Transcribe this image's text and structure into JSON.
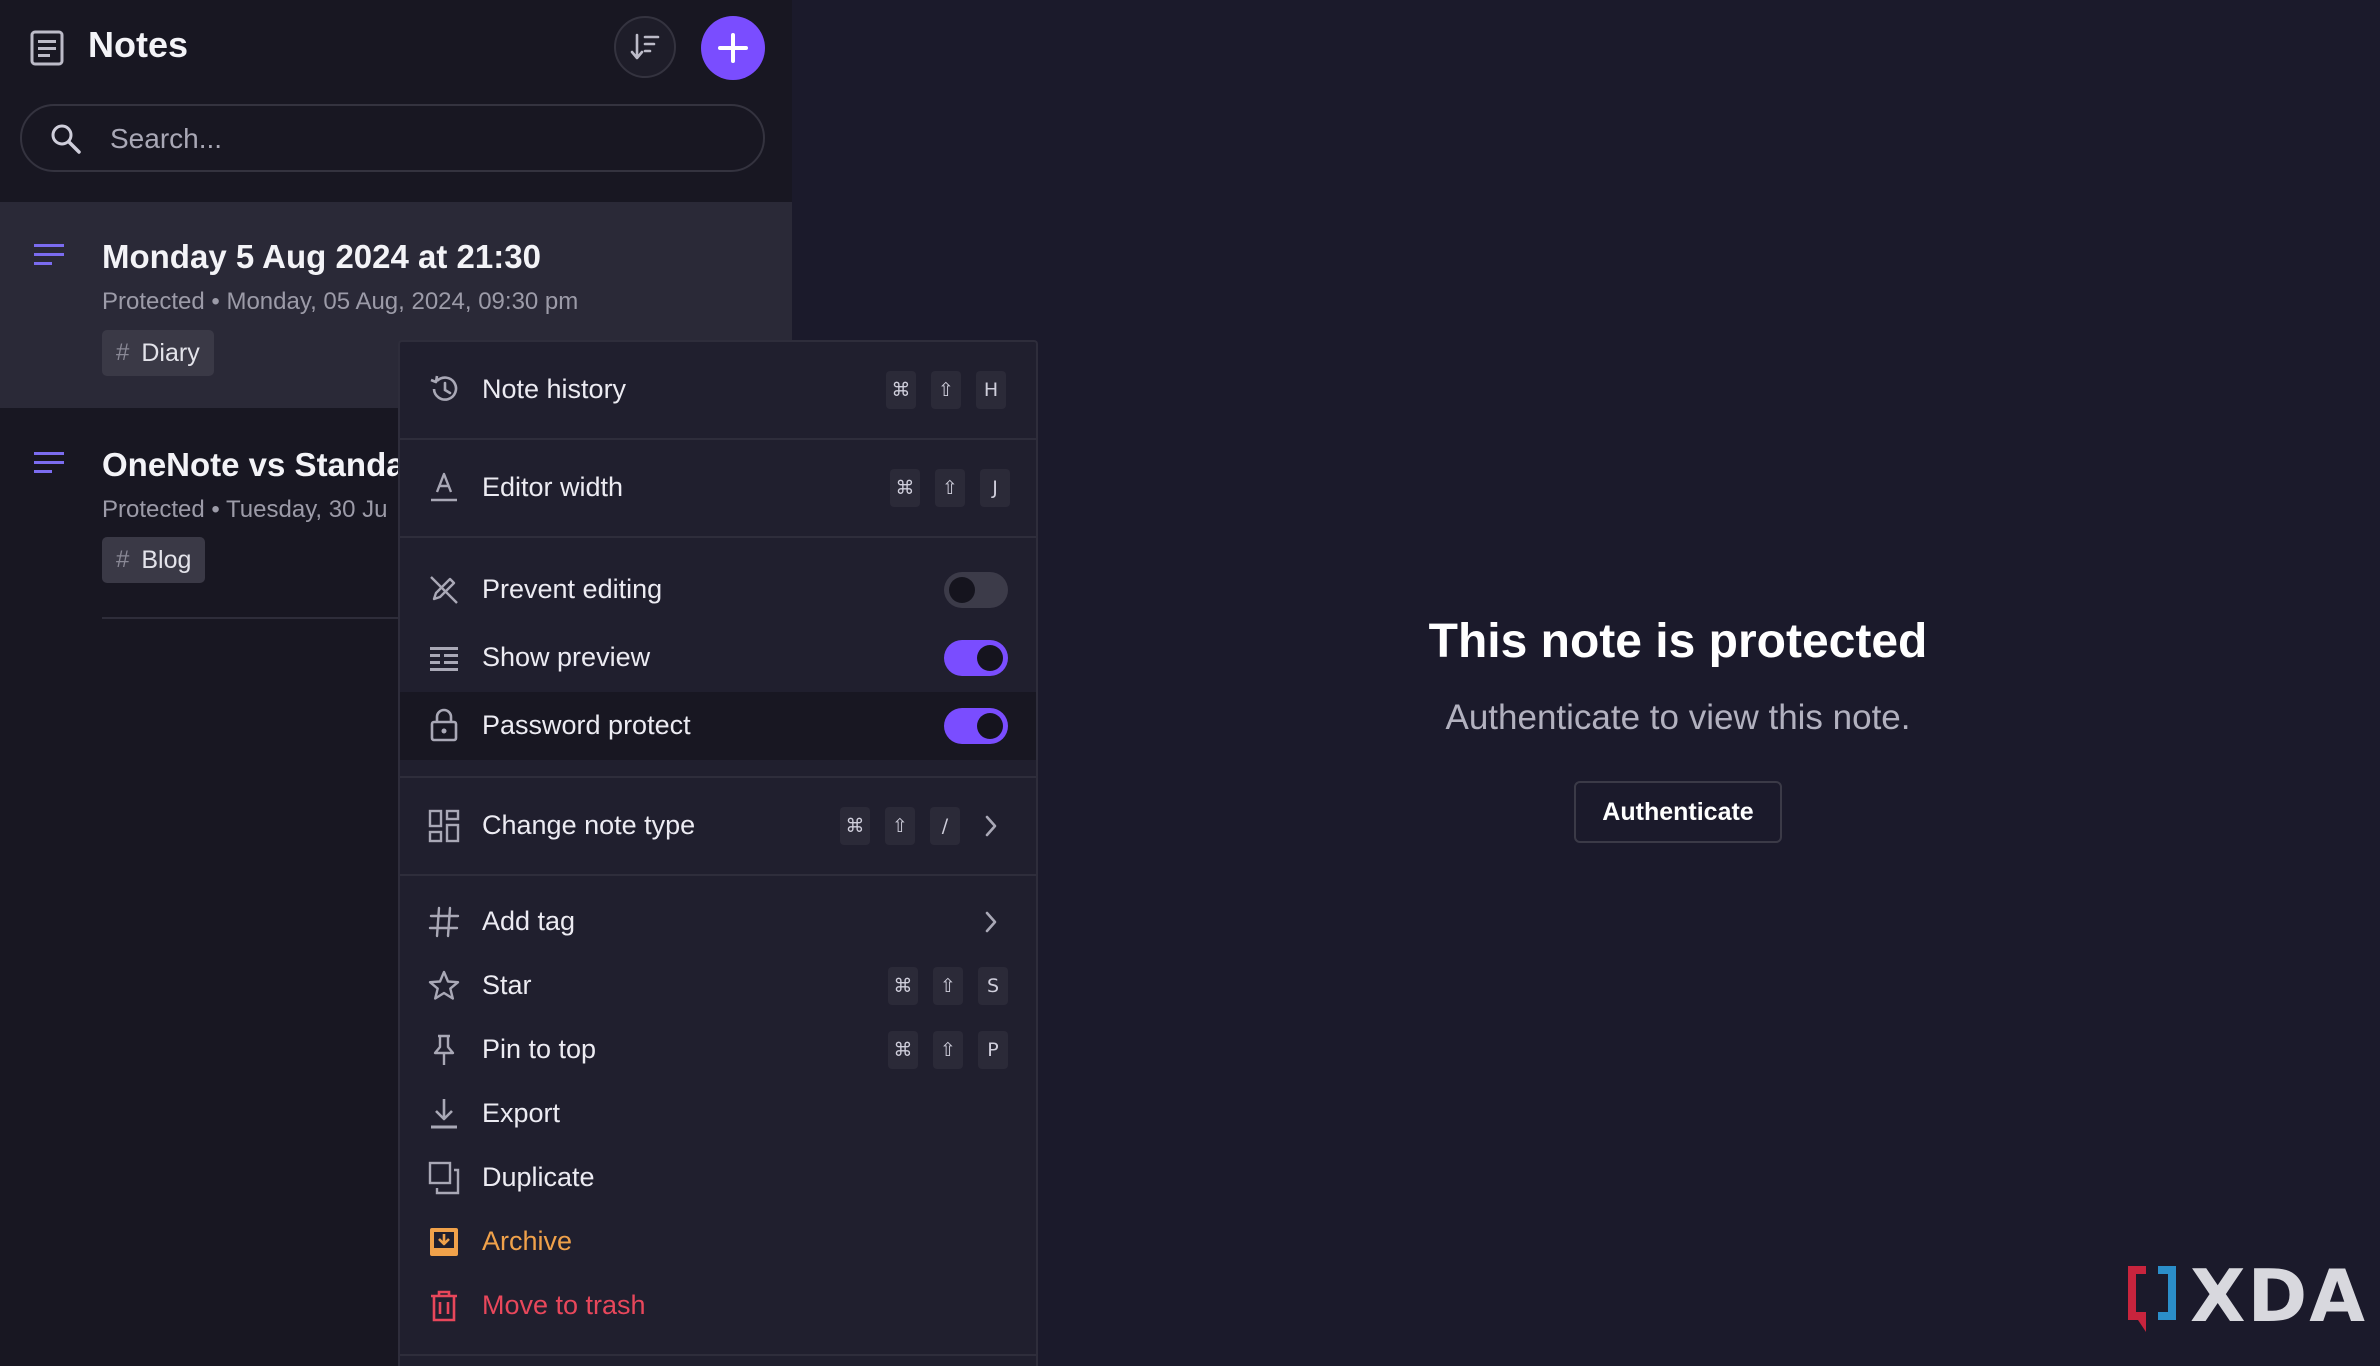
{
  "header": {
    "title": "Notes"
  },
  "search": {
    "placeholder": "Search..."
  },
  "notes": [
    {
      "title": "Monday 5 Aug 2024 at 21:30",
      "meta": "Protected • Monday, 05 Aug, 2024, 09:30 pm",
      "tag": "Diary"
    },
    {
      "title": "OneNote vs Standard",
      "meta": "Protected • Tuesday, 30 Ju",
      "tag": "Blog"
    }
  ],
  "main": {
    "title": "This note is protected",
    "subtitle": "Authenticate to view this note.",
    "button": "Authenticate"
  },
  "menu": {
    "note_history": {
      "label": "Note history",
      "keys": [
        "⌘",
        "⇧",
        "H"
      ]
    },
    "editor_width": {
      "label": "Editor width",
      "keys": [
        "⌘",
        "⇧",
        "J"
      ]
    },
    "prevent_editing": {
      "label": "Prevent editing",
      "on": false
    },
    "show_preview": {
      "label": "Show preview",
      "on": true
    },
    "password_protect": {
      "label": "Password protect",
      "on": true
    },
    "change_note_type": {
      "label": "Change note type",
      "keys": [
        "⌘",
        "⇧",
        "/"
      ]
    },
    "add_tag": {
      "label": "Add tag"
    },
    "star": {
      "label": "Star",
      "keys": [
        "⌘",
        "⇧",
        "S"
      ]
    },
    "pin_to_top": {
      "label": "Pin to top",
      "keys": [
        "⌘",
        "⇧",
        "P"
      ]
    },
    "export": {
      "label": "Export"
    },
    "duplicate": {
      "label": "Duplicate"
    },
    "archive": {
      "label": "Archive"
    },
    "move_to_trash": {
      "label": "Move to trash"
    }
  },
  "colors": {
    "accent": "#7a4dff",
    "archive": "#f0a14a",
    "trash": "#e8475b",
    "note_icon": "#7b6cf0"
  },
  "watermark": {
    "text": "XDA"
  }
}
